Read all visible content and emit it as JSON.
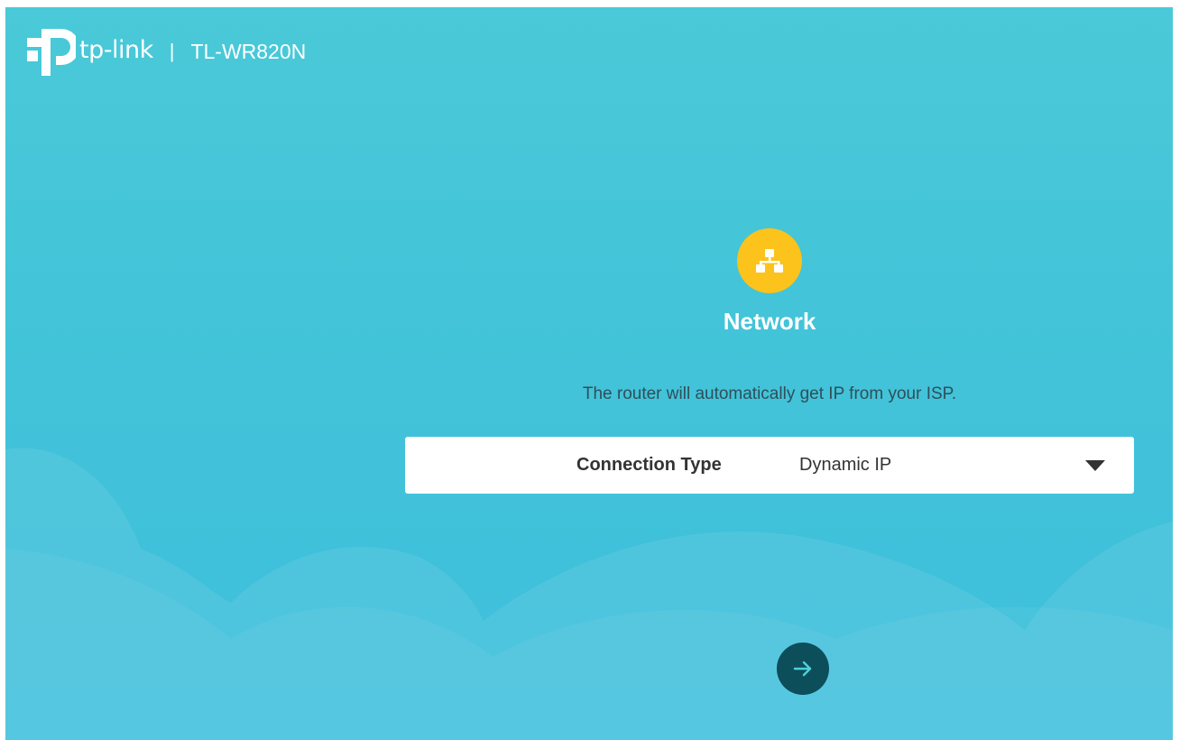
{
  "header": {
    "brand": "tp-link",
    "separator": "|",
    "model": "TL-WR820N"
  },
  "page": {
    "title": "Network",
    "description": "The router will automatically get IP from your ISP.",
    "icon": "network-topology-icon"
  },
  "connection": {
    "label": "Connection Type",
    "value": "Dynamic IP"
  },
  "actions": {
    "next_icon": "arrow-right-icon"
  },
  "colors": {
    "background": "#43c4d8",
    "icon_circle": "#fbc31c",
    "next_button": "#0d4e5b",
    "text_dark": "#2f4f5a"
  }
}
